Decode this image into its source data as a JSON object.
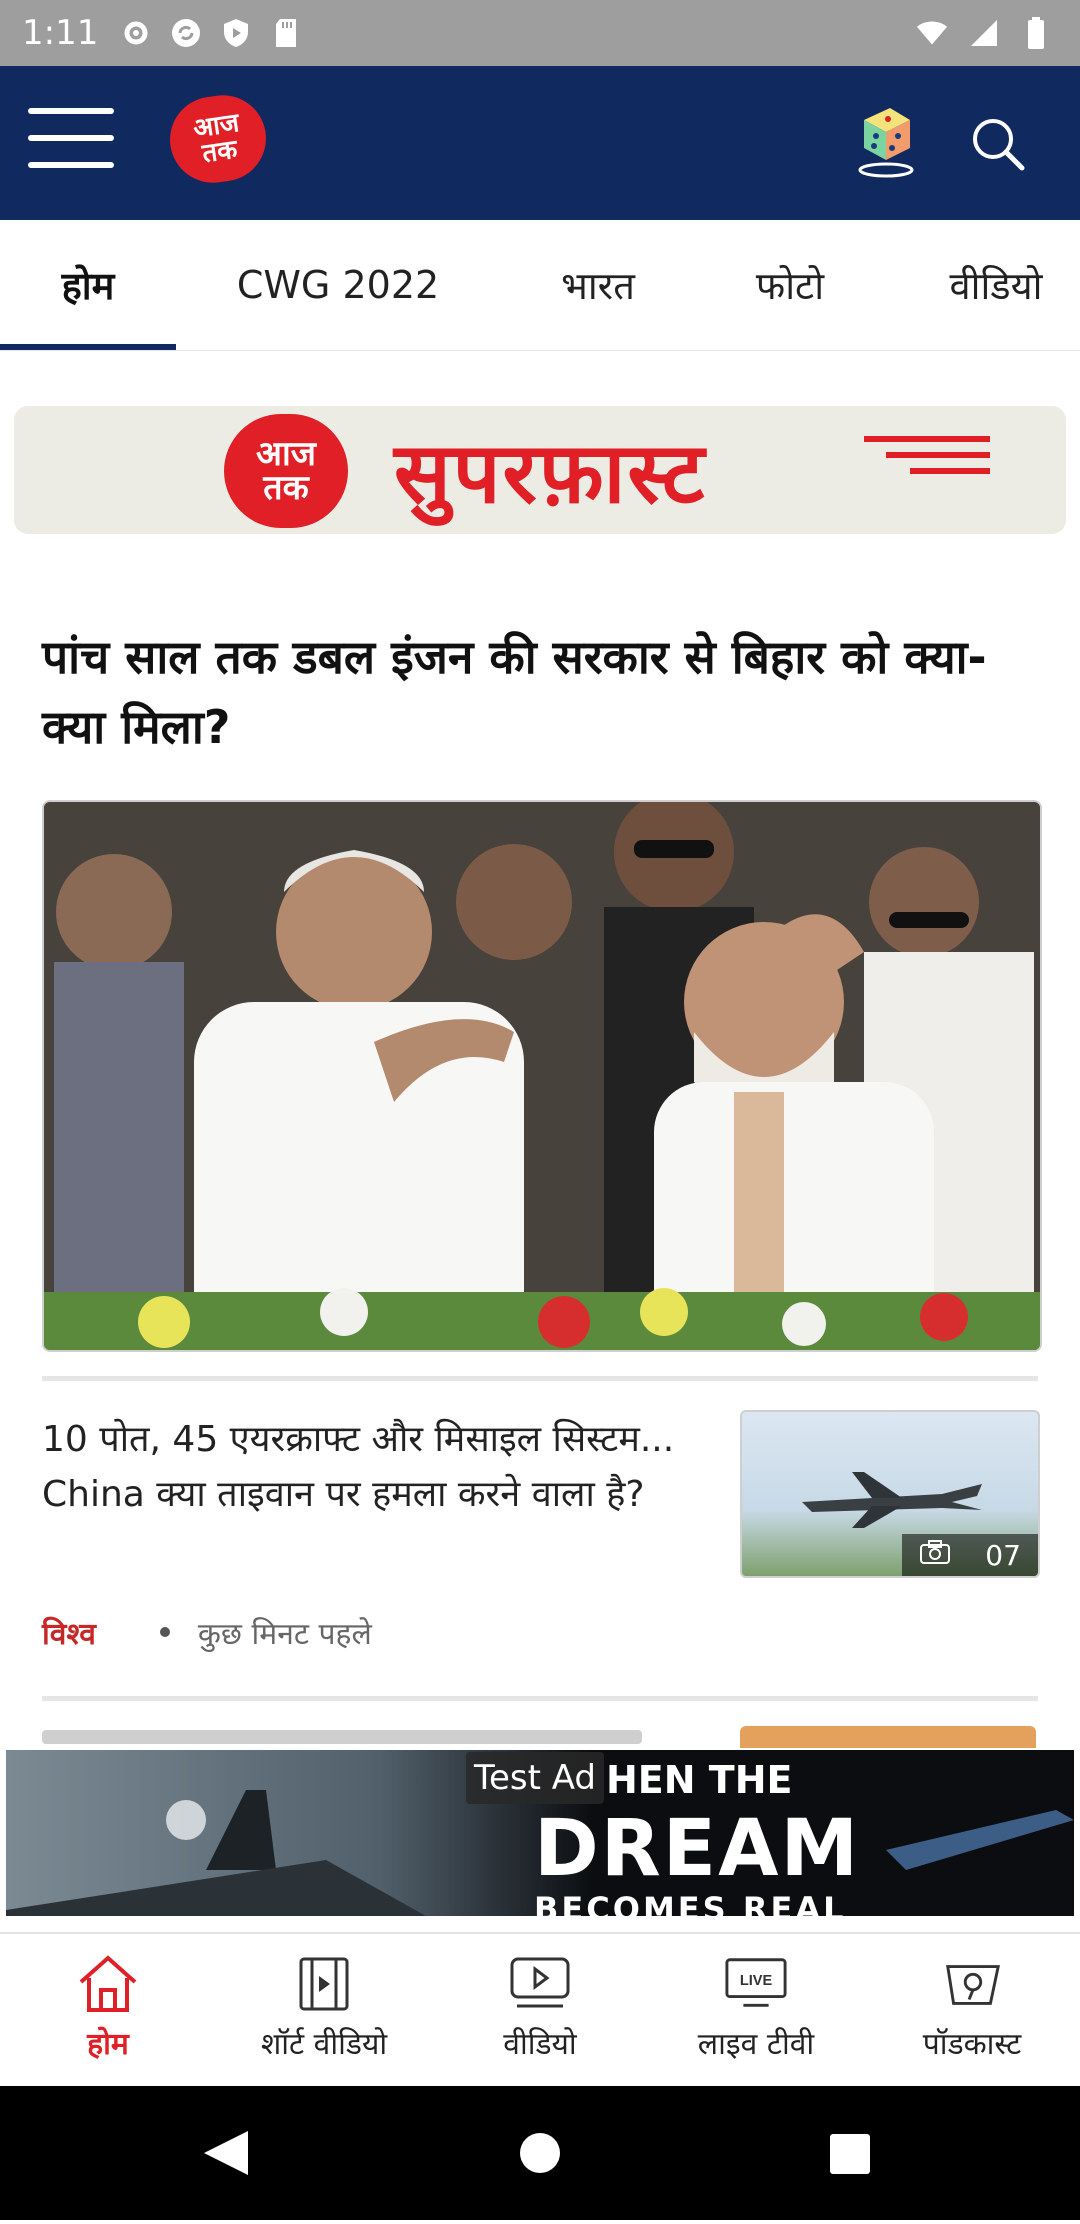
{
  "status_bar": {
    "time": "1:11"
  },
  "header": {
    "logo_text_top": "आज",
    "logo_text_bottom": "तक"
  },
  "tabs": [
    {
      "label": "होम",
      "active": true
    },
    {
      "label": "CWG 2022",
      "active": false
    },
    {
      "label": "भारत",
      "active": false
    },
    {
      "label": "फोटो",
      "active": false
    },
    {
      "label": "वीडियो",
      "active": false
    }
  ],
  "superfast": {
    "logo_top": "आज",
    "logo_bottom": "तक",
    "title": "सुपरफ़ास्ट"
  },
  "top_story": {
    "headline": "पांच साल तक डबल इंजन की सरकार से बिहार को क्या-क्या मिला?"
  },
  "article": {
    "title": "10 पोत, 45 एयरक्राफ्ट और मिसाइल सिस्टम... China क्या ताइवान पर हमला करने वाला है?",
    "photo_count": "07",
    "category": "विश्व",
    "time_ago": "कुछ मिनट पहले"
  },
  "ad": {
    "label": "Test Ad",
    "line1": "HEN THE",
    "line2": "DREAM",
    "line3": "BECOMES REAL"
  },
  "bottom_nav": [
    {
      "label": "होम",
      "icon": "home-icon",
      "active": true
    },
    {
      "label": "शॉर्ट वीडियो",
      "icon": "short-video-icon",
      "active": false
    },
    {
      "label": "वीडियो",
      "icon": "video-play-icon",
      "active": false
    },
    {
      "label": "लाइव टीवी",
      "icon": "live-tv-icon",
      "active": false
    },
    {
      "label": "पॉडकास्ट",
      "icon": "podcast-icon",
      "active": false
    }
  ],
  "bottom_nav_live_badge": "LIVE",
  "colors": {
    "header_bg": "#10295f",
    "accent_red": "#e02026",
    "category_red": "#c62828"
  }
}
